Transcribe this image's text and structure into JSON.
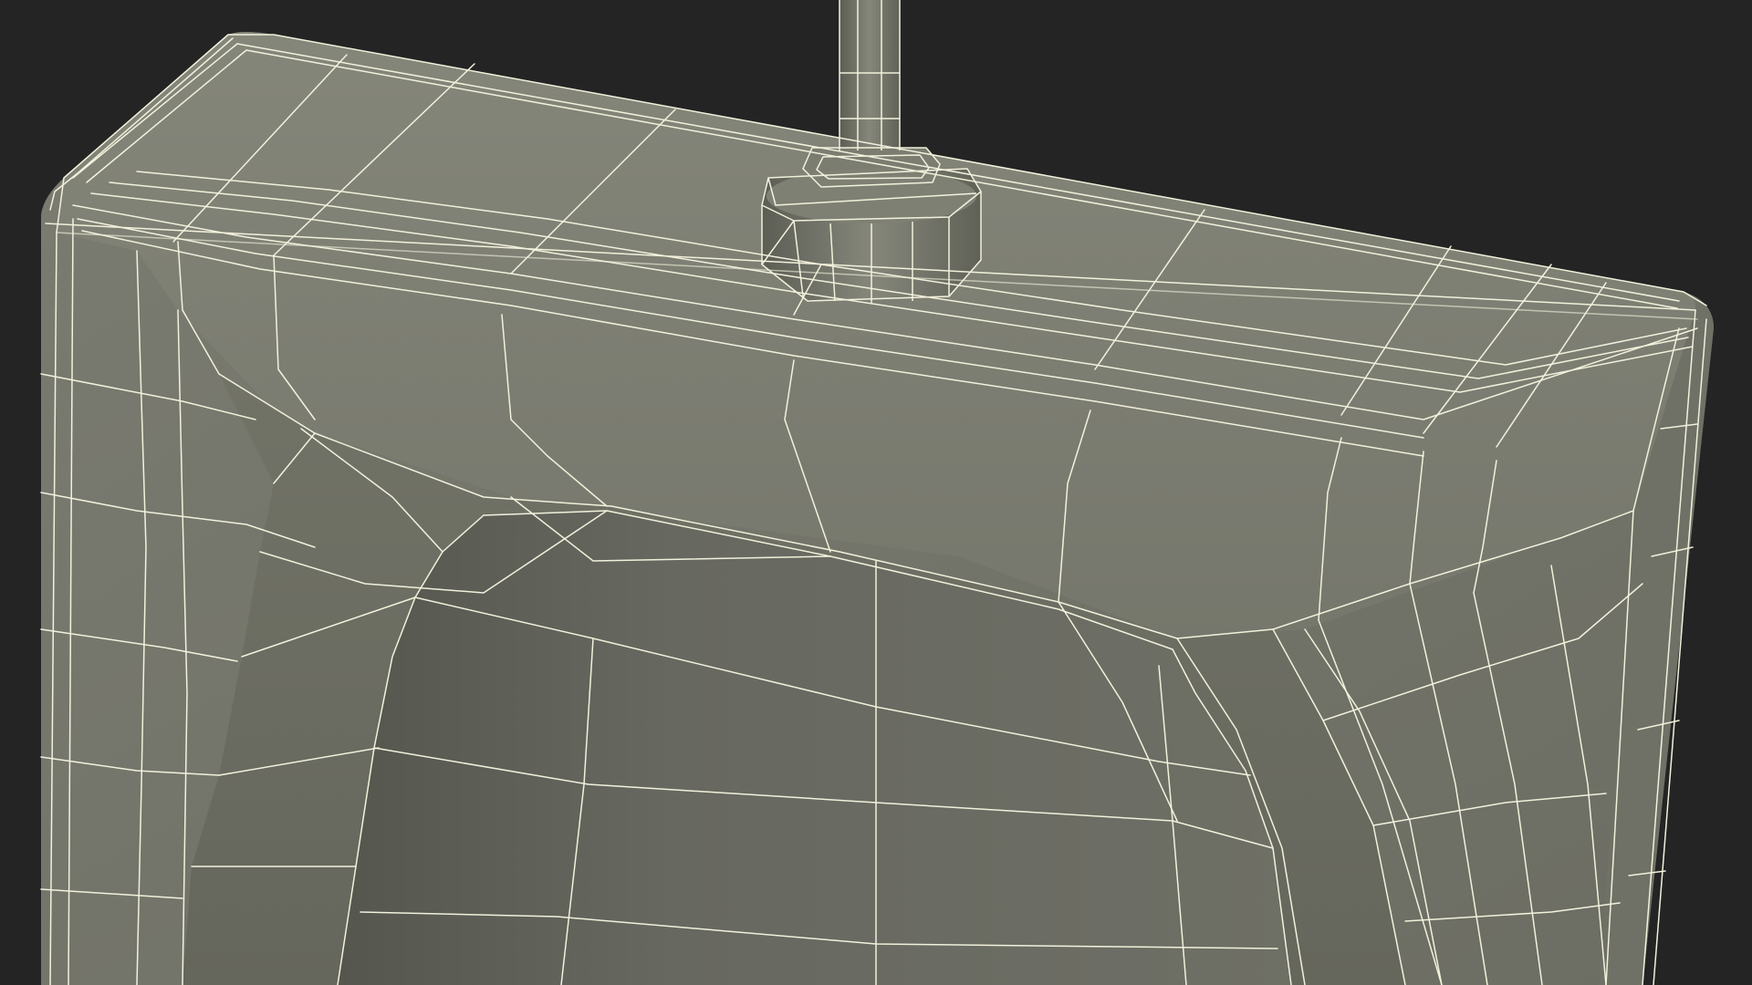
{
  "scene": {
    "subject": "wireframe-render-urinal-with-flush-pipe",
    "render_style": "shaded-with-wireframe-overlay"
  },
  "colors": {
    "background": "#242424",
    "surface_light": "#7d7e72",
    "surface_mid": "#727368",
    "surface_dark": "#64655b",
    "inner_dark": "#5a5b52",
    "wire": "#f2f1dc"
  }
}
